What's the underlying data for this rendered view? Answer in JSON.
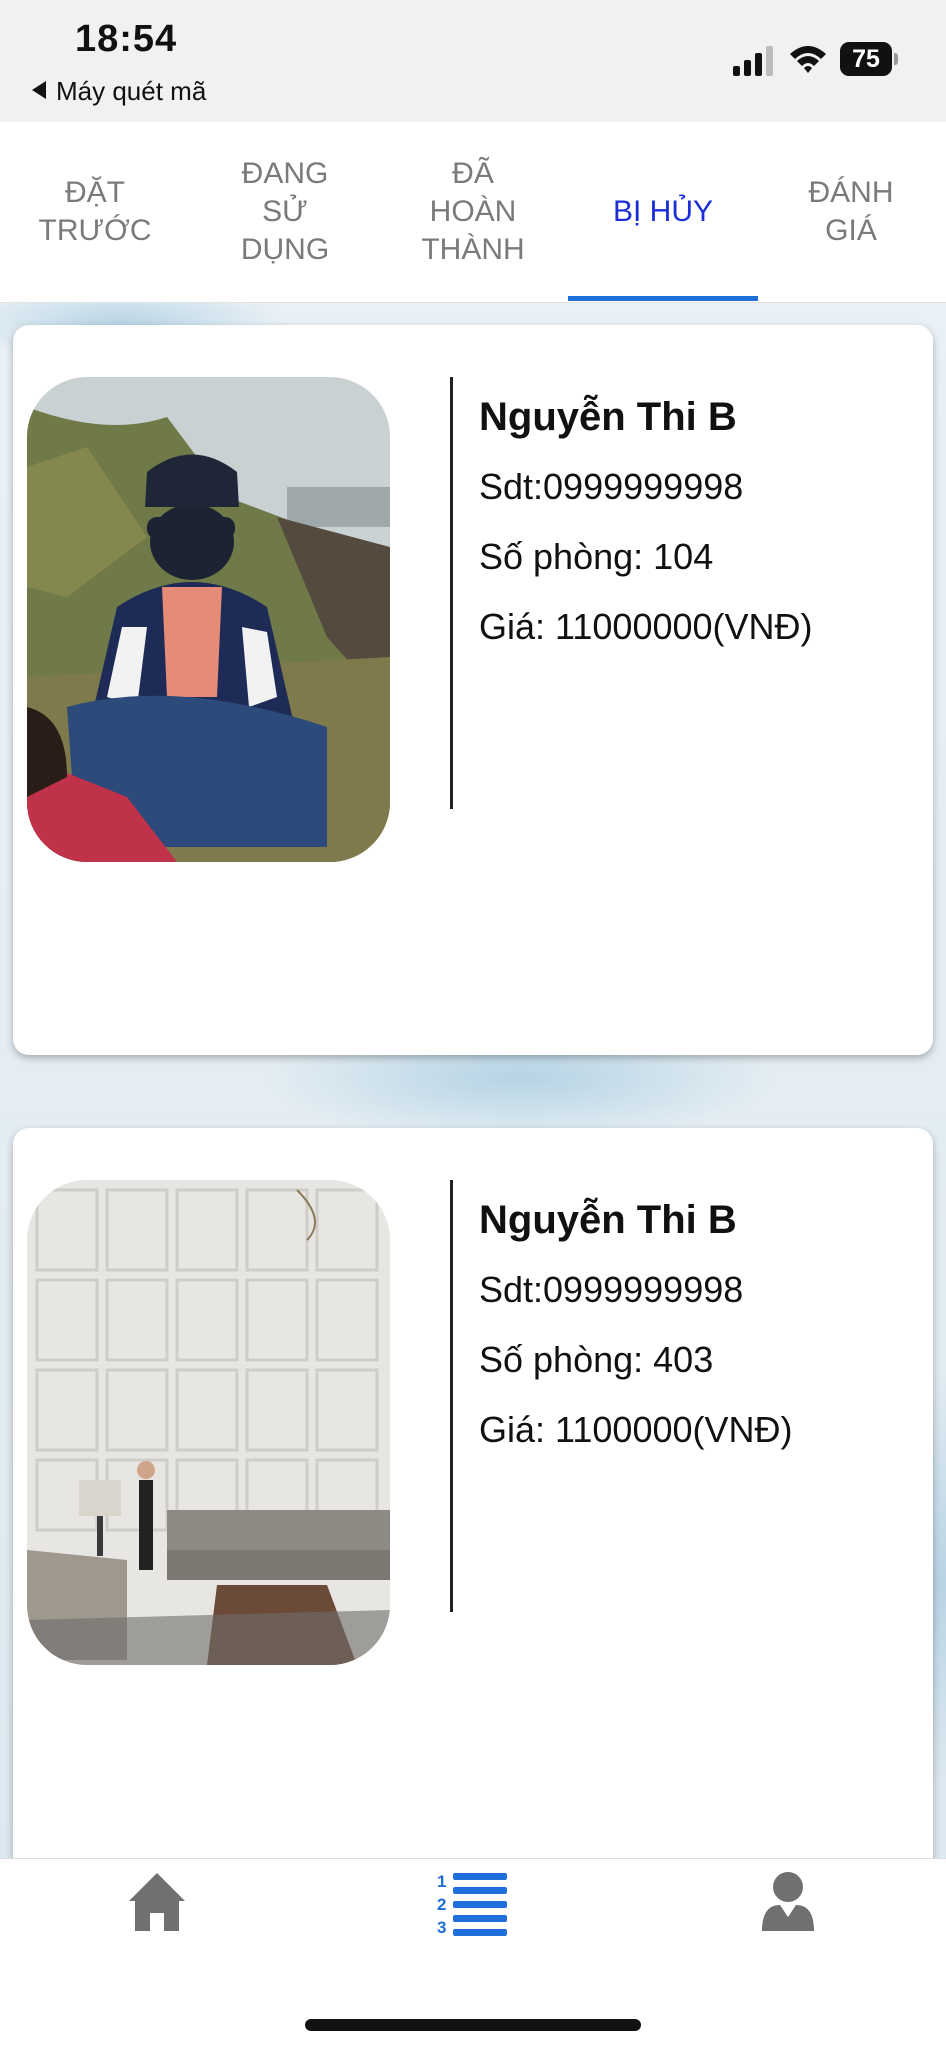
{
  "status_bar": {
    "time": "18:54",
    "back_app": "Máy quét mã",
    "battery": "75",
    "icons": [
      "signal-icon",
      "wifi-icon",
      "battery-icon"
    ]
  },
  "tabs": [
    {
      "label": "ĐẶT TRƯỚC",
      "active": false
    },
    {
      "label": "ĐANG SỬ DỤNG",
      "active": false
    },
    {
      "label": "ĐÃ HOÀN THÀNH",
      "active": false
    },
    {
      "label": "BỊ HỦY",
      "active": true
    },
    {
      "label": "ĐÁNH GIÁ",
      "active": false
    }
  ],
  "bookings": [
    {
      "name": "Nguyễn Thi B",
      "phone": "Sdt:0999999998",
      "room": "Số phòng: 104",
      "price": "Giá: 11000000(VNĐ)",
      "photo_icon": "person-outdoor-photo"
    },
    {
      "name": "Nguyễn Thi B",
      "phone": "Sdt:0999999998",
      "room": "Số phòng: 403",
      "price": "Giá: 1100000(VNĐ)",
      "photo_icon": "hotel-room-photo"
    }
  ],
  "bottom_nav": [
    "home-icon",
    "numbered-list-icon",
    "user-icon"
  ],
  "colors": {
    "active_tab": "#1a2fd6",
    "tab_indicator": "#1e6fd9",
    "nav_active": "#1e6fd9",
    "nav_inactive": "#707070"
  }
}
